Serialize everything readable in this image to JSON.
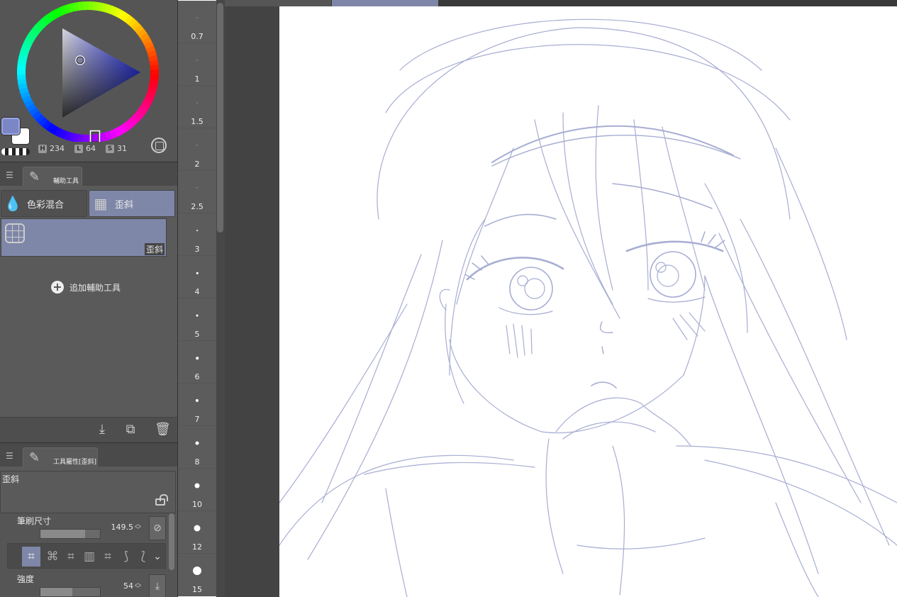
{
  "color_panel": {
    "hue_label": "H",
    "hue_value": "234",
    "lightness_label": "L",
    "lightness_value": "64",
    "saturation_label": "S",
    "saturation_value": "31",
    "foreground_color": "#7a86c6",
    "background_color": "#ffffff"
  },
  "subtool_panel": {
    "tab_label": "輔助工具",
    "tools": [
      {
        "label": "色彩混合",
        "icon": "water-drops-icon"
      },
      {
        "label": "歪斜",
        "icon": "grid-warp-icon"
      }
    ],
    "selected_tool": "歪斜",
    "add_label": "追加輔助工具"
  },
  "tool_property": {
    "tab_label": "工具屬性[歪斜]",
    "tool_name": "歪斜",
    "brush_size_label": "筆刷尺寸",
    "brush_size_value": "149.5",
    "brush_size_fraction": 0.75,
    "strength_label": "強度",
    "strength_value": "54",
    "strength_fraction": 0.54
  },
  "brush_sizes": [
    "0.7",
    "1",
    "1.5",
    "2",
    "2.5",
    "3",
    "4",
    "5",
    "6",
    "7",
    "8",
    "10",
    "12",
    "15"
  ],
  "colors": {
    "accent": "#7e87a8",
    "sketch_stroke": "#8a92c4",
    "panel_bg": "#5a5a5a"
  }
}
